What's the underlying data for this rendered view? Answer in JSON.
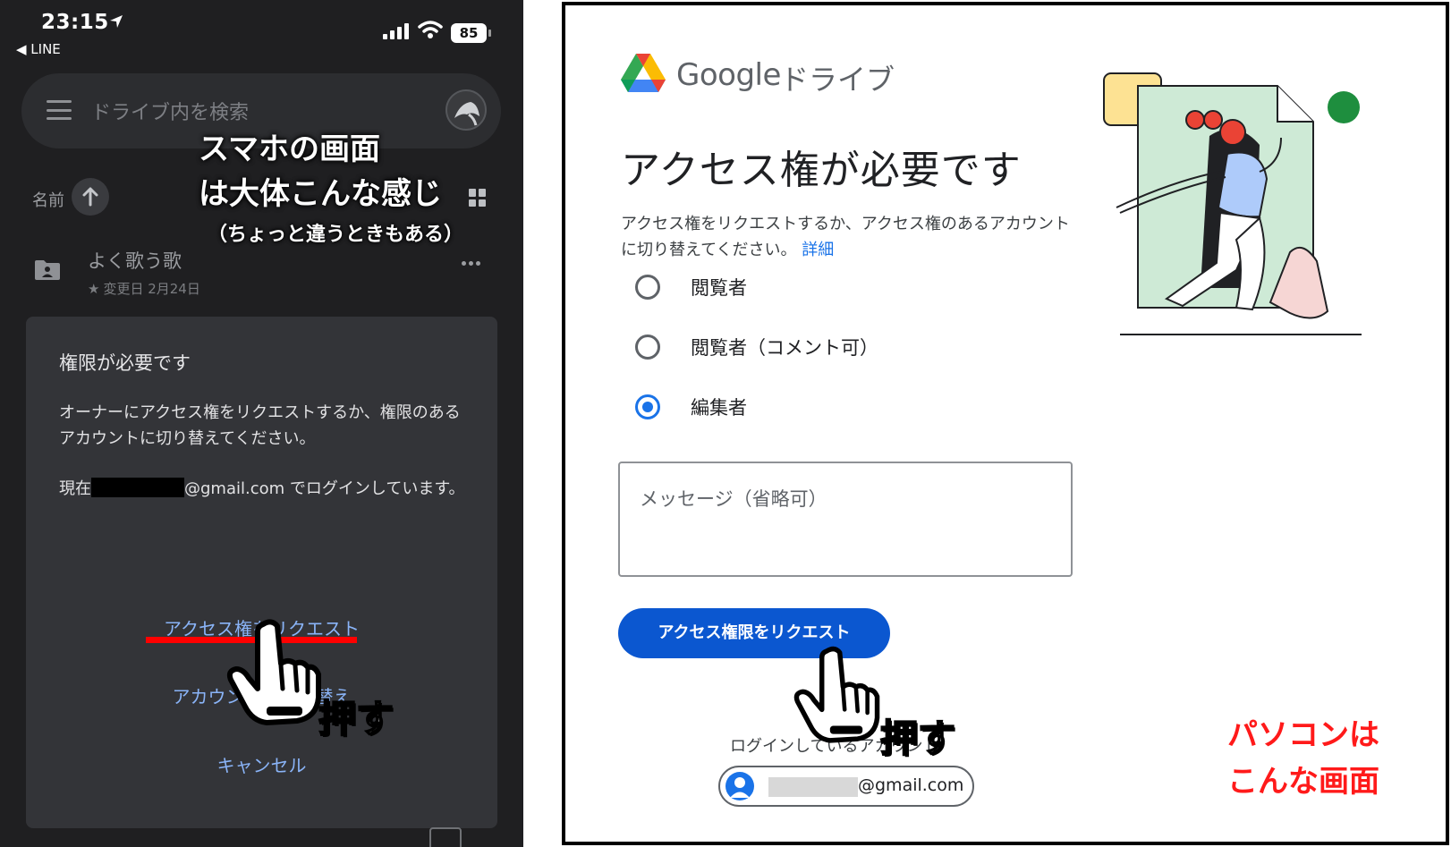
{
  "colors": {
    "phone_bg": "#1f1f21",
    "dialog_bg": "#333438",
    "link_blue_dark": "#8ab4f8",
    "google_blue": "#0b57d0",
    "annotation_red": "#ff0000"
  },
  "phone": {
    "status": {
      "time": "23:15",
      "back_app": "◀ LINE",
      "battery": "85"
    },
    "search": {
      "placeholder": "ドライブ内を検索",
      "menu_icon": "hamburger-icon"
    },
    "sort": {
      "label": "名前",
      "icon": "arrow-up-icon"
    },
    "file": {
      "name": "よく歌う歌",
      "modified": "変更日 2月24日",
      "icon": "shared-folder-icon"
    },
    "dialog": {
      "title": "権限が必要です",
      "body": "オーナーにアクセス権をリクエストするか、権限のあるアカウントに切り替えてください。",
      "login_prefix": "現在",
      "login_suffix": "@gmail.com でログインしています。",
      "request_button": "アクセス権をリクエスト",
      "switch_button": "アカウントを切り替え",
      "cancel_button": "キャンセル"
    },
    "annotation": {
      "title_line1": "スマホの画面",
      "title_line2": "は大体こんな感じ",
      "subtitle": "（ちょっと違うときもある）",
      "press": "押す"
    }
  },
  "desktop": {
    "brand": {
      "google": "Google",
      "product": "ドライブ"
    },
    "title": "アクセス権が必要です",
    "description": "アクセス権をリクエストするか、アクセス権のあるアカウントに切り替えてください。",
    "details_link": "詳細",
    "roles": [
      {
        "label": "閲覧者",
        "selected": false
      },
      {
        "label": "閲覧者（コメント可）",
        "selected": false
      },
      {
        "label": "編集者",
        "selected": true
      }
    ],
    "message_placeholder": "メッセージ（省略可）",
    "request_button": "アクセス権限をリクエスト",
    "login_text": "ログインしているアカウント",
    "account_email": "@gmail.com",
    "annotation": {
      "press": "押す",
      "caption_line1": "パソコンは",
      "caption_line2": "こんな画面"
    }
  }
}
